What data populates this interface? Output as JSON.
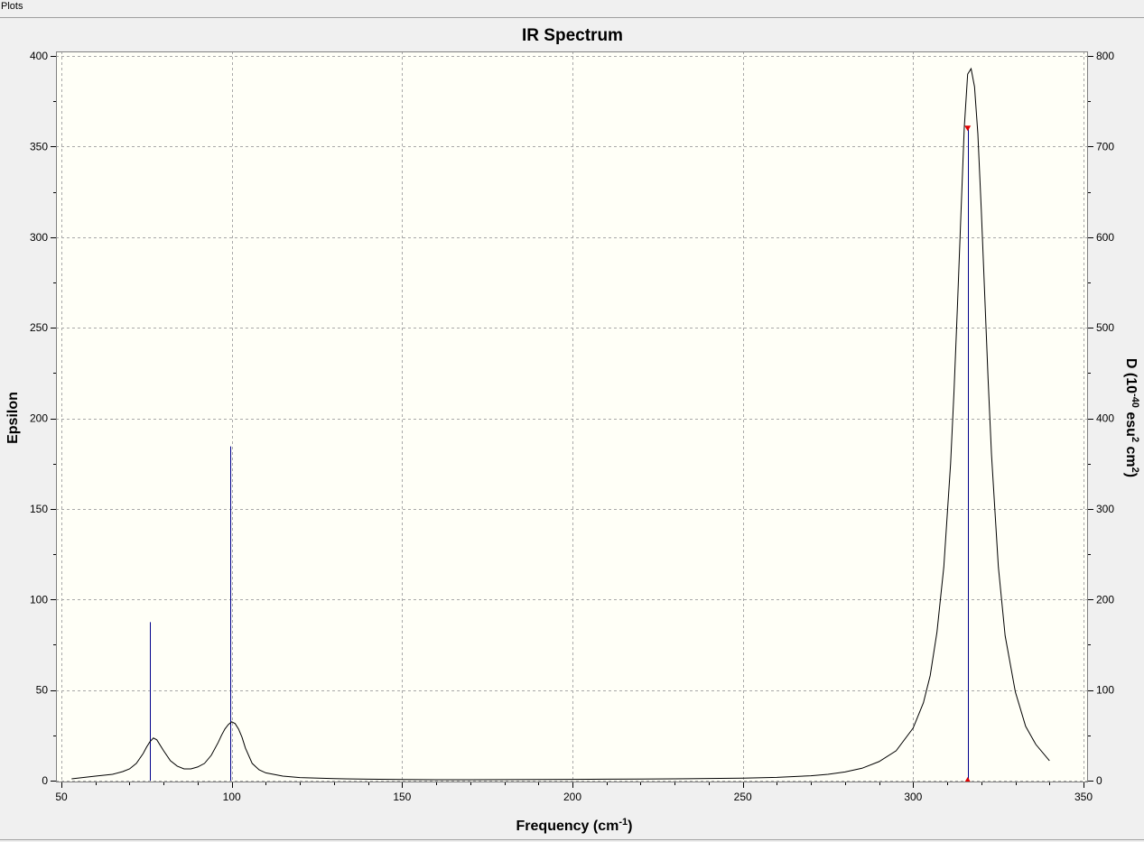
{
  "menu": {
    "plots_label": "Plots"
  },
  "chart_data": {
    "type": "line",
    "title": "IR Spectrum",
    "xlabel": "Frequency (cm-1)",
    "ylabel": "Epsilon",
    "y2label": "D (10-40 esu2 cm2)",
    "xlim": [
      50,
      350
    ],
    "ylim": [
      0,
      400
    ],
    "y2lim": [
      0,
      800
    ],
    "xticks": [
      50,
      100,
      150,
      200,
      250,
      300,
      350
    ],
    "yticks": [
      0,
      50,
      100,
      150,
      200,
      250,
      300,
      350,
      400
    ],
    "y2ticks": [
      0,
      100,
      200,
      300,
      400,
      500,
      600,
      700,
      800
    ],
    "grid": true,
    "colors": {
      "plot_bg": "#fffff7",
      "curve": "#000000",
      "sticks": "#00008b",
      "marker": "#e00000",
      "grid": "#a8a8a8"
    },
    "spectrum": {
      "x": [
        53,
        60,
        65,
        68,
        70,
        72,
        74,
        75,
        76,
        77,
        78,
        80,
        82,
        84,
        86,
        88,
        90,
        92,
        94,
        96,
        97,
        98,
        99,
        100,
        101,
        102,
        103,
        104,
        106,
        108,
        110,
        115,
        120,
        130,
        140,
        150,
        160,
        170,
        180,
        190,
        200,
        210,
        220,
        230,
        240,
        250,
        260,
        270,
        275,
        280,
        285,
        290,
        295,
        300,
        303,
        305,
        307,
        309,
        311,
        312,
        313,
        314,
        315,
        316,
        317,
        318,
        319,
        320,
        321,
        322,
        323,
        325,
        327,
        330,
        333,
        336,
        340
      ],
      "y": [
        1,
        2.5,
        3.5,
        5,
        6.5,
        9.5,
        15,
        18.5,
        21.5,
        23.5,
        22.5,
        16.5,
        11,
        8,
        6.5,
        6.5,
        7.5,
        9.5,
        14,
        21,
        25,
        28.5,
        31,
        32.5,
        31.5,
        28.5,
        24,
        18,
        9.5,
        6,
        4.3,
        2.5,
        1.7,
        1.1,
        0.8,
        0.6,
        0.5,
        0.5,
        0.55,
        0.6,
        0.7,
        0.8,
        0.9,
        1.0,
        1.2,
        1.4,
        1.8,
        2.7,
        3.5,
        4.8,
        6.8,
        10.5,
        16.5,
        29,
        43,
        58,
        82,
        118,
        175,
        215,
        262,
        312,
        360,
        390,
        393,
        383,
        357,
        315,
        268,
        222,
        180,
        118,
        80,
        49,
        30,
        20,
        11
      ]
    },
    "sticks": [
      {
        "x": 76,
        "y": 87.5
      },
      {
        "x": 99.5,
        "y": 184.5
      },
      {
        "x": 316,
        "y": 360
      }
    ],
    "selected": {
      "x": 316,
      "y": 360
    }
  }
}
